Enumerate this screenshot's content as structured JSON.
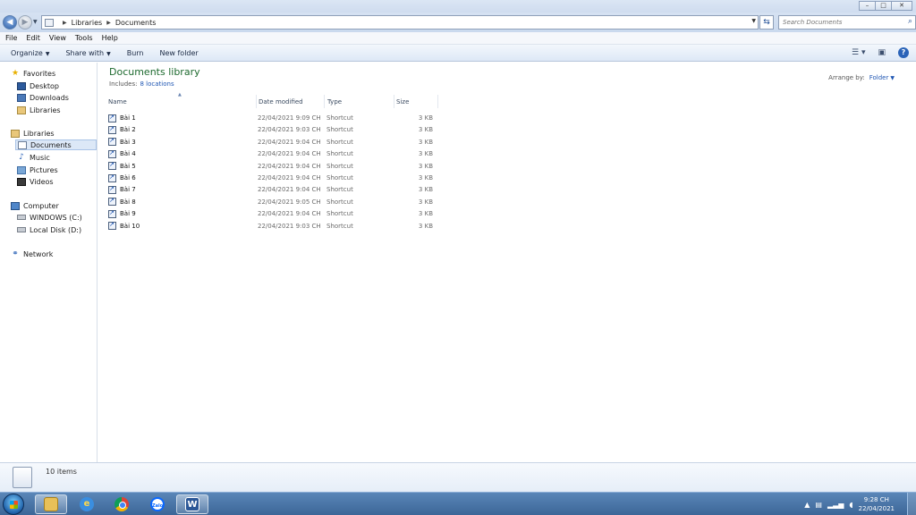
{
  "window": {
    "controls": {
      "minimize": "–",
      "maximize": "□",
      "close": "✕"
    }
  },
  "address": {
    "crumbs": [
      "Libraries",
      "Documents"
    ],
    "search_placeholder": "Search Documents"
  },
  "menu": [
    "File",
    "Edit",
    "View",
    "Tools",
    "Help"
  ],
  "toolbar": {
    "organize": "Organize",
    "share_with": "Share with",
    "burn": "Burn",
    "new_folder": "New folder"
  },
  "nav": {
    "favorites": {
      "label": "Favorites",
      "items": [
        "Desktop",
        "Downloads",
        "Libraries"
      ]
    },
    "libraries": {
      "label": "Libraries",
      "items": [
        "Documents",
        "Music",
        "Pictures",
        "Videos"
      ]
    },
    "computer": {
      "label": "Computer",
      "items": [
        "WINDOWS (C:)",
        "Local Disk (D:)"
      ]
    },
    "network": {
      "label": "Network"
    }
  },
  "library": {
    "title": "Documents library",
    "includes_label": "Includes:",
    "includes_link": "8 locations",
    "arrange_label": "Arrange by:",
    "arrange_value": "Folder"
  },
  "columns": {
    "name": "Name",
    "date": "Date modified",
    "type": "Type",
    "size": "Size"
  },
  "files": [
    {
      "name": "Bài 1",
      "date": "22/04/2021 9:09 CH",
      "type": "Shortcut",
      "size": "3 KB"
    },
    {
      "name": "Bài 2",
      "date": "22/04/2021 9:03 CH",
      "type": "Shortcut",
      "size": "3 KB"
    },
    {
      "name": "Bài 3",
      "date": "22/04/2021 9:04 CH",
      "type": "Shortcut",
      "size": "3 KB"
    },
    {
      "name": "Bài 4",
      "date": "22/04/2021 9:04 CH",
      "type": "Shortcut",
      "size": "3 KB"
    },
    {
      "name": "Bài 5",
      "date": "22/04/2021 9:04 CH",
      "type": "Shortcut",
      "size": "3 KB"
    },
    {
      "name": "Bài 6",
      "date": "22/04/2021 9:04 CH",
      "type": "Shortcut",
      "size": "3 KB"
    },
    {
      "name": "Bài 7",
      "date": "22/04/2021 9:04 CH",
      "type": "Shortcut",
      "size": "3 KB"
    },
    {
      "name": "Bài 8",
      "date": "22/04/2021 9:05 CH",
      "type": "Shortcut",
      "size": "3 KB"
    },
    {
      "name": "Bài 9",
      "date": "22/04/2021 9:04 CH",
      "type": "Shortcut",
      "size": "3 KB"
    },
    {
      "name": "Bài 10",
      "date": "22/04/2021 9:03 CH",
      "type": "Shortcut",
      "size": "3 KB"
    }
  ],
  "status": {
    "item_count": "10 items"
  },
  "taskbar": {
    "apps": [
      "windows-explorer",
      "internet-explorer",
      "google-chrome",
      "zalo",
      "microsoft-word"
    ],
    "zalo_text": "Zalo",
    "word_text": "W",
    "time": "9:28 CH",
    "date": "22/04/2021"
  },
  "colors": {
    "library_title": "#1e6a2f",
    "link": "#1f56b3",
    "taskbar": "#3c6697"
  }
}
